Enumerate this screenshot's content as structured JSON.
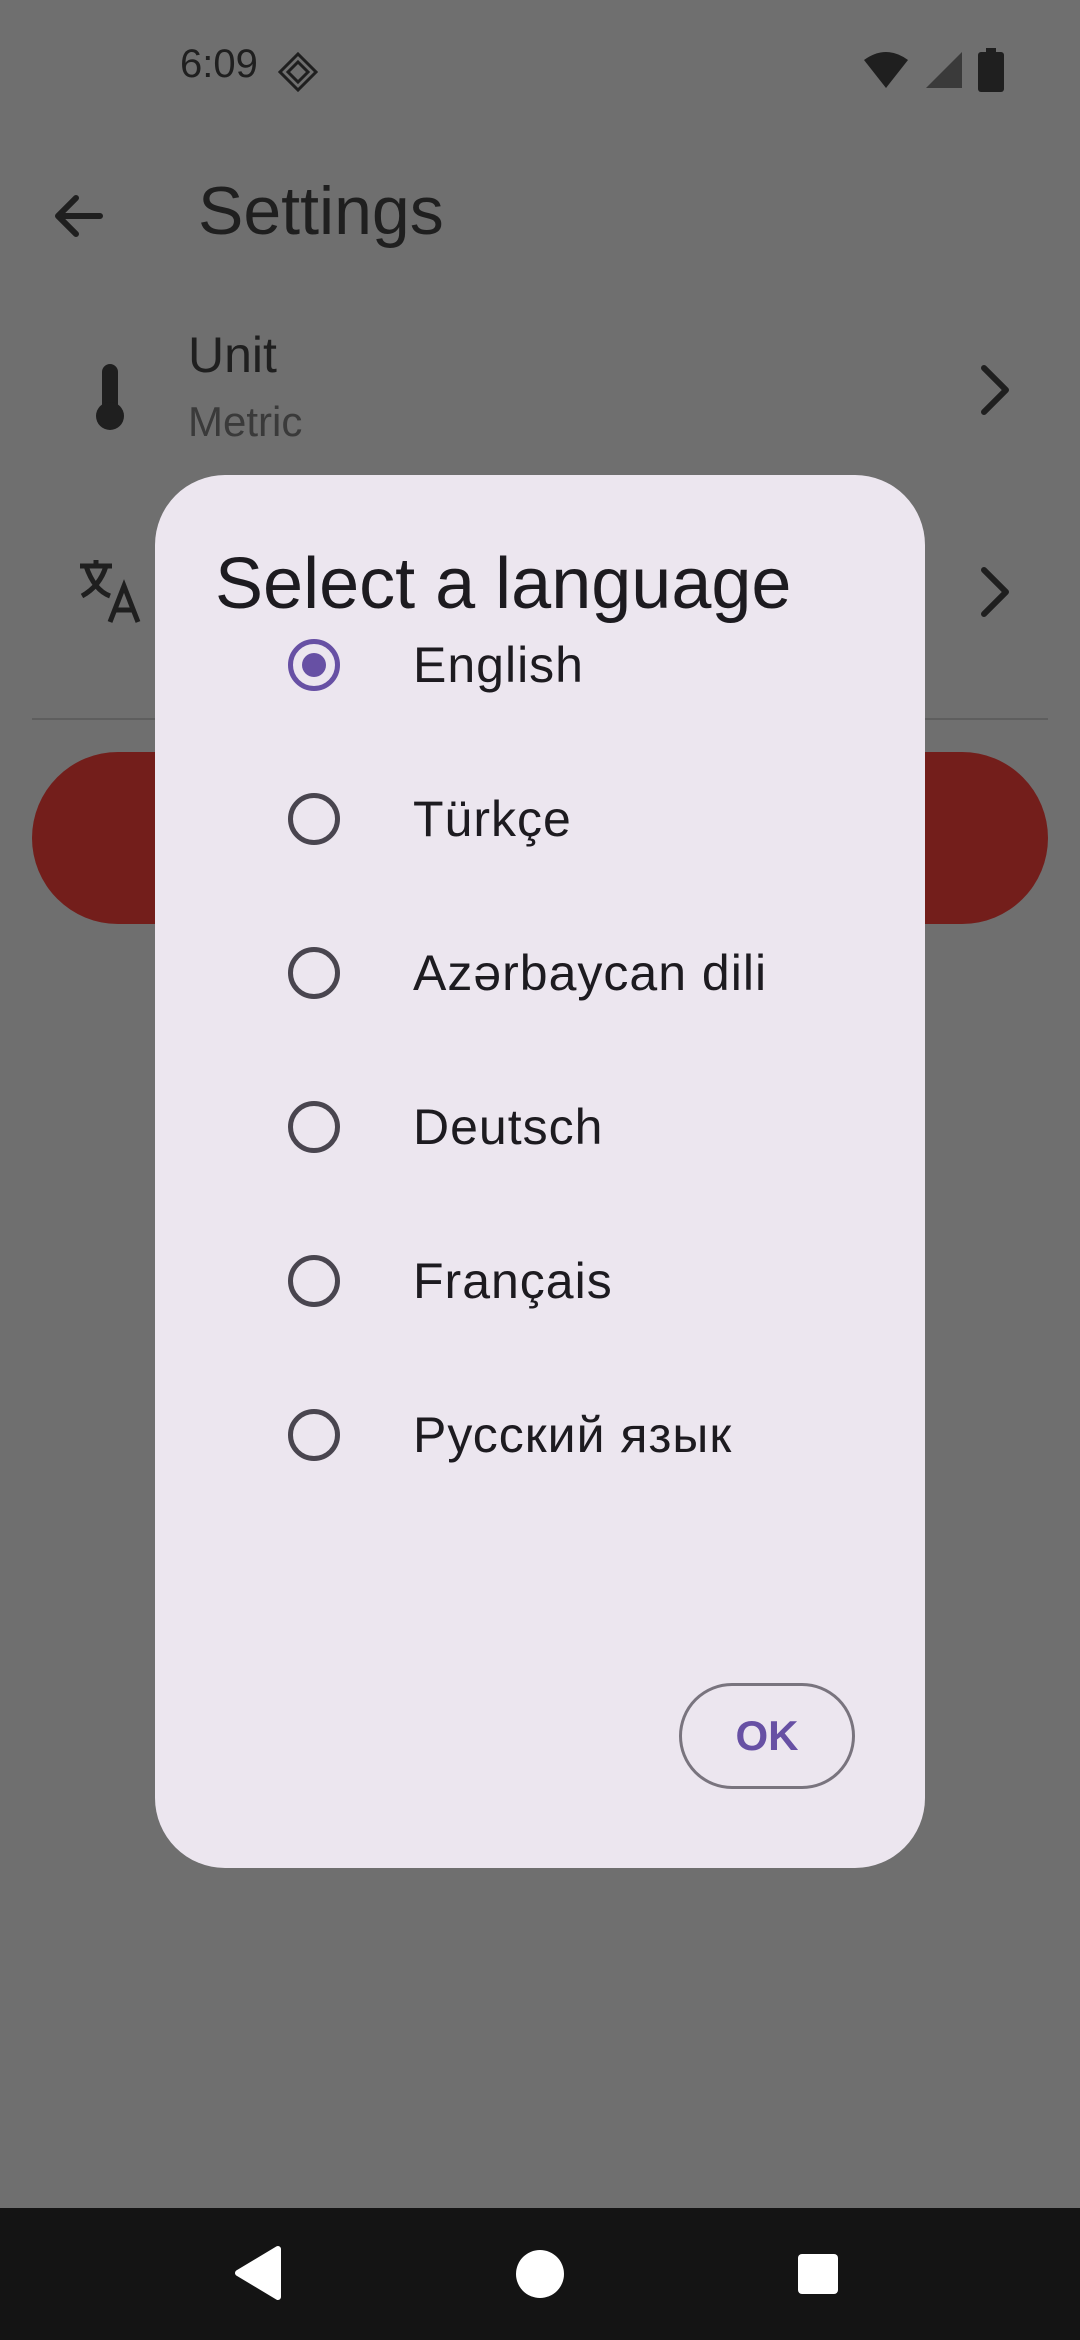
{
  "status_bar": {
    "time": "6:09"
  },
  "app_bar": {
    "title": "Settings"
  },
  "settings": {
    "unit": {
      "title": "Unit",
      "value": "Metric"
    }
  },
  "dialog": {
    "title": "Select a language",
    "selected_index": 0,
    "options": [
      {
        "label": "English",
        "checked": true
      },
      {
        "label": "Türkçe",
        "checked": false
      },
      {
        "label": "Azərbaycan dili",
        "checked": false
      },
      {
        "label": "Deutsch",
        "checked": false
      },
      {
        "label": "Français",
        "checked": false
      },
      {
        "label": "Русский язык",
        "checked": false
      }
    ],
    "ok_label": "OK"
  },
  "colors": {
    "accent": "#6750a4",
    "dialog_bg": "#ece6ef",
    "scrim": "#6f6f6f",
    "danger_button": "#731e1b"
  }
}
